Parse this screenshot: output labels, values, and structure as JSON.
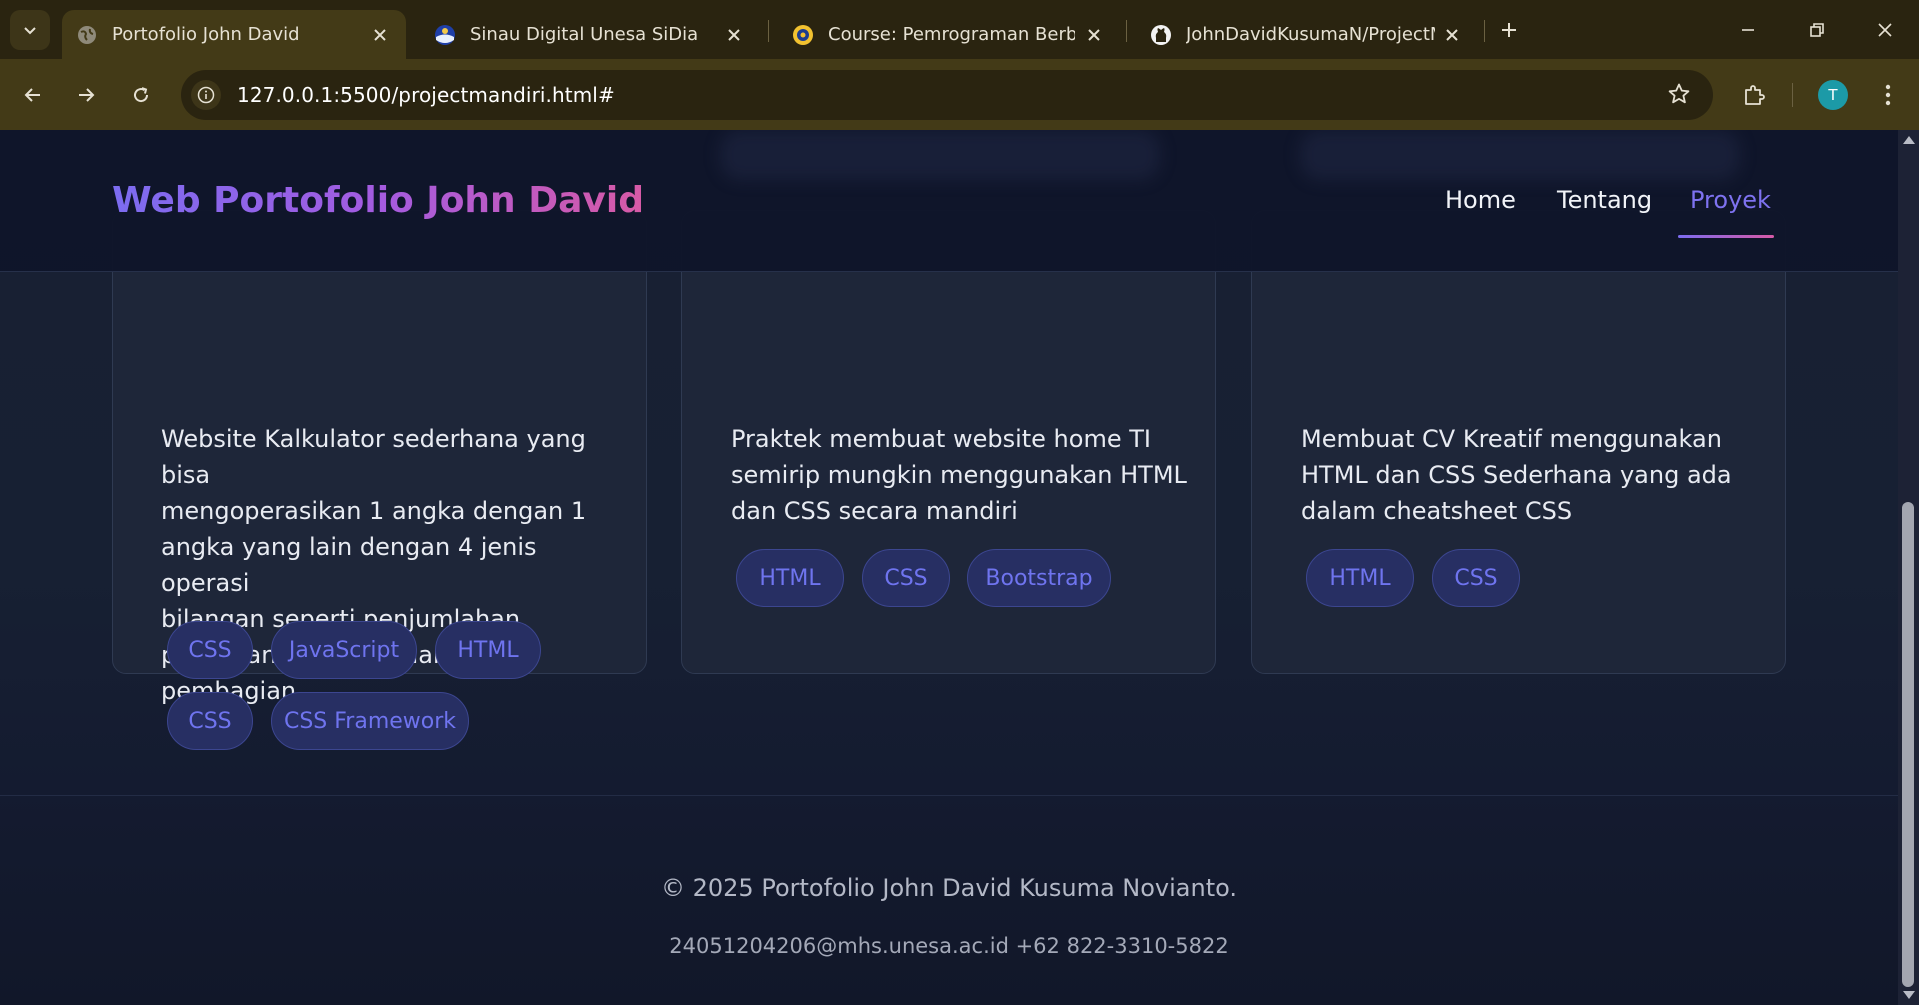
{
  "browser": {
    "tabs": [
      {
        "title": "Portofolio John David",
        "active": true,
        "icon": "globe-icon"
      },
      {
        "title": "Sinau Digital Unesa SiDia",
        "active": false,
        "icon": "sidia-icon"
      },
      {
        "title": "Course: Pemrograman Berbasis",
        "active": false,
        "icon": "unesa-icon"
      },
      {
        "title": "JohnDavidKusumaN/ProjectMandiri",
        "active": false,
        "icon": "github-icon"
      }
    ],
    "url": "127.0.0.1:5500/projectmandiri.html#",
    "profile_initial": "T"
  },
  "header": {
    "brand": "Web Portofolio John David",
    "nav": [
      {
        "label": "Home",
        "active": false
      },
      {
        "label": "Tentang",
        "active": false
      },
      {
        "label": "Proyek",
        "active": true
      }
    ]
  },
  "projects": [
    {
      "description_lines": [
        "Website Kalkulator sederhana yang bisa",
        "mengoperasikan 1 angka dengan 1",
        "angka yang lain dengan 4 jenis operasi",
        "bilangan seperti penjumlahan,",
        "pengurangan, perkalian, dan pembagian"
      ],
      "tags": [
        "CSS",
        "JavaScript",
        "HTML",
        "CSS",
        "CSS Framework"
      ]
    },
    {
      "description_lines": [
        "Praktek membuat website home TI",
        "semirip mungkin menggunakan HTML",
        "dan CSS secara mandiri"
      ],
      "tags": [
        "HTML",
        "CSS",
        "Bootstrap"
      ]
    },
    {
      "description_lines": [
        "Membuat CV Kreatif menggunakan",
        "HTML dan CSS Sederhana yang ada",
        "dalam cheatsheet CSS"
      ],
      "tags": [
        "HTML",
        "CSS"
      ]
    }
  ],
  "footer": {
    "copyright": "© 2025 Portofolio John David Kusuma Novianto.",
    "contact": "24051204206@mhs.unesa.ac.id +62 822-3310-5822"
  },
  "colors": {
    "accent": "#7c6cf0",
    "accent_pink": "#d75aa6",
    "chip_text": "#6f74ef",
    "page_bg": "#172033",
    "chrome_bg": "#433a17"
  }
}
